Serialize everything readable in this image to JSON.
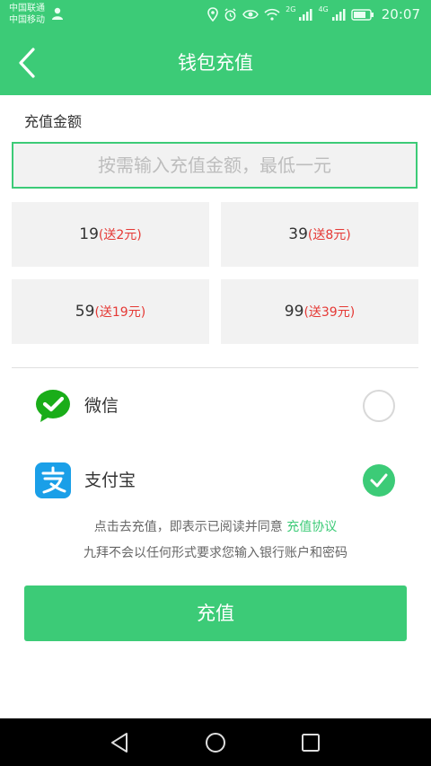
{
  "status_bar": {
    "carrier1": "中国联通",
    "carrier2": "中国移动",
    "net1": "2G",
    "net2": "4G",
    "time": "20:07"
  },
  "nav": {
    "title": "钱包充值"
  },
  "amount": {
    "label": "充值金额",
    "placeholder": "按需输入充值金额，最低一元",
    "options": [
      {
        "price": "19",
        "bonus": "(送2元)"
      },
      {
        "price": "39",
        "bonus": "(送8元)"
      },
      {
        "price": "59",
        "bonus": "(送19元)"
      },
      {
        "price": "99",
        "bonus": "(送39元)"
      }
    ]
  },
  "payment": {
    "methods": [
      {
        "label": "微信",
        "icon": "wechat-icon",
        "selected": false
      },
      {
        "label": "支付宝",
        "icon": "alipay-icon",
        "selected": true
      }
    ]
  },
  "notice": {
    "line1_prefix": "点击去充值，即表示已阅读并同意",
    "agreement_link": "充值协议",
    "line2": "九拜不会以任何形式要求您输入银行账户和密码"
  },
  "submit_label": "充值",
  "colors": {
    "accent": "#3ccb77",
    "bonus": "#e53935",
    "wechat": "#1aad19",
    "alipay": "#1a9fe8"
  }
}
